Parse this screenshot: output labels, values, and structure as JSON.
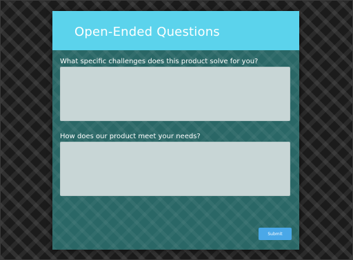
{
  "form": {
    "title": "Open-Ended Questions",
    "questions": [
      {
        "label": "What specific challenges does this product solve for you?",
        "value": ""
      },
      {
        "label": "How does our product meet your needs?",
        "value": ""
      }
    ],
    "submit_label": "Submit"
  },
  "colors": {
    "header": "#5bd3ec",
    "card": "#2a6766",
    "textarea": "#c8d6d6",
    "submit": "#4aa8e8",
    "background": "#1b1b1b"
  }
}
